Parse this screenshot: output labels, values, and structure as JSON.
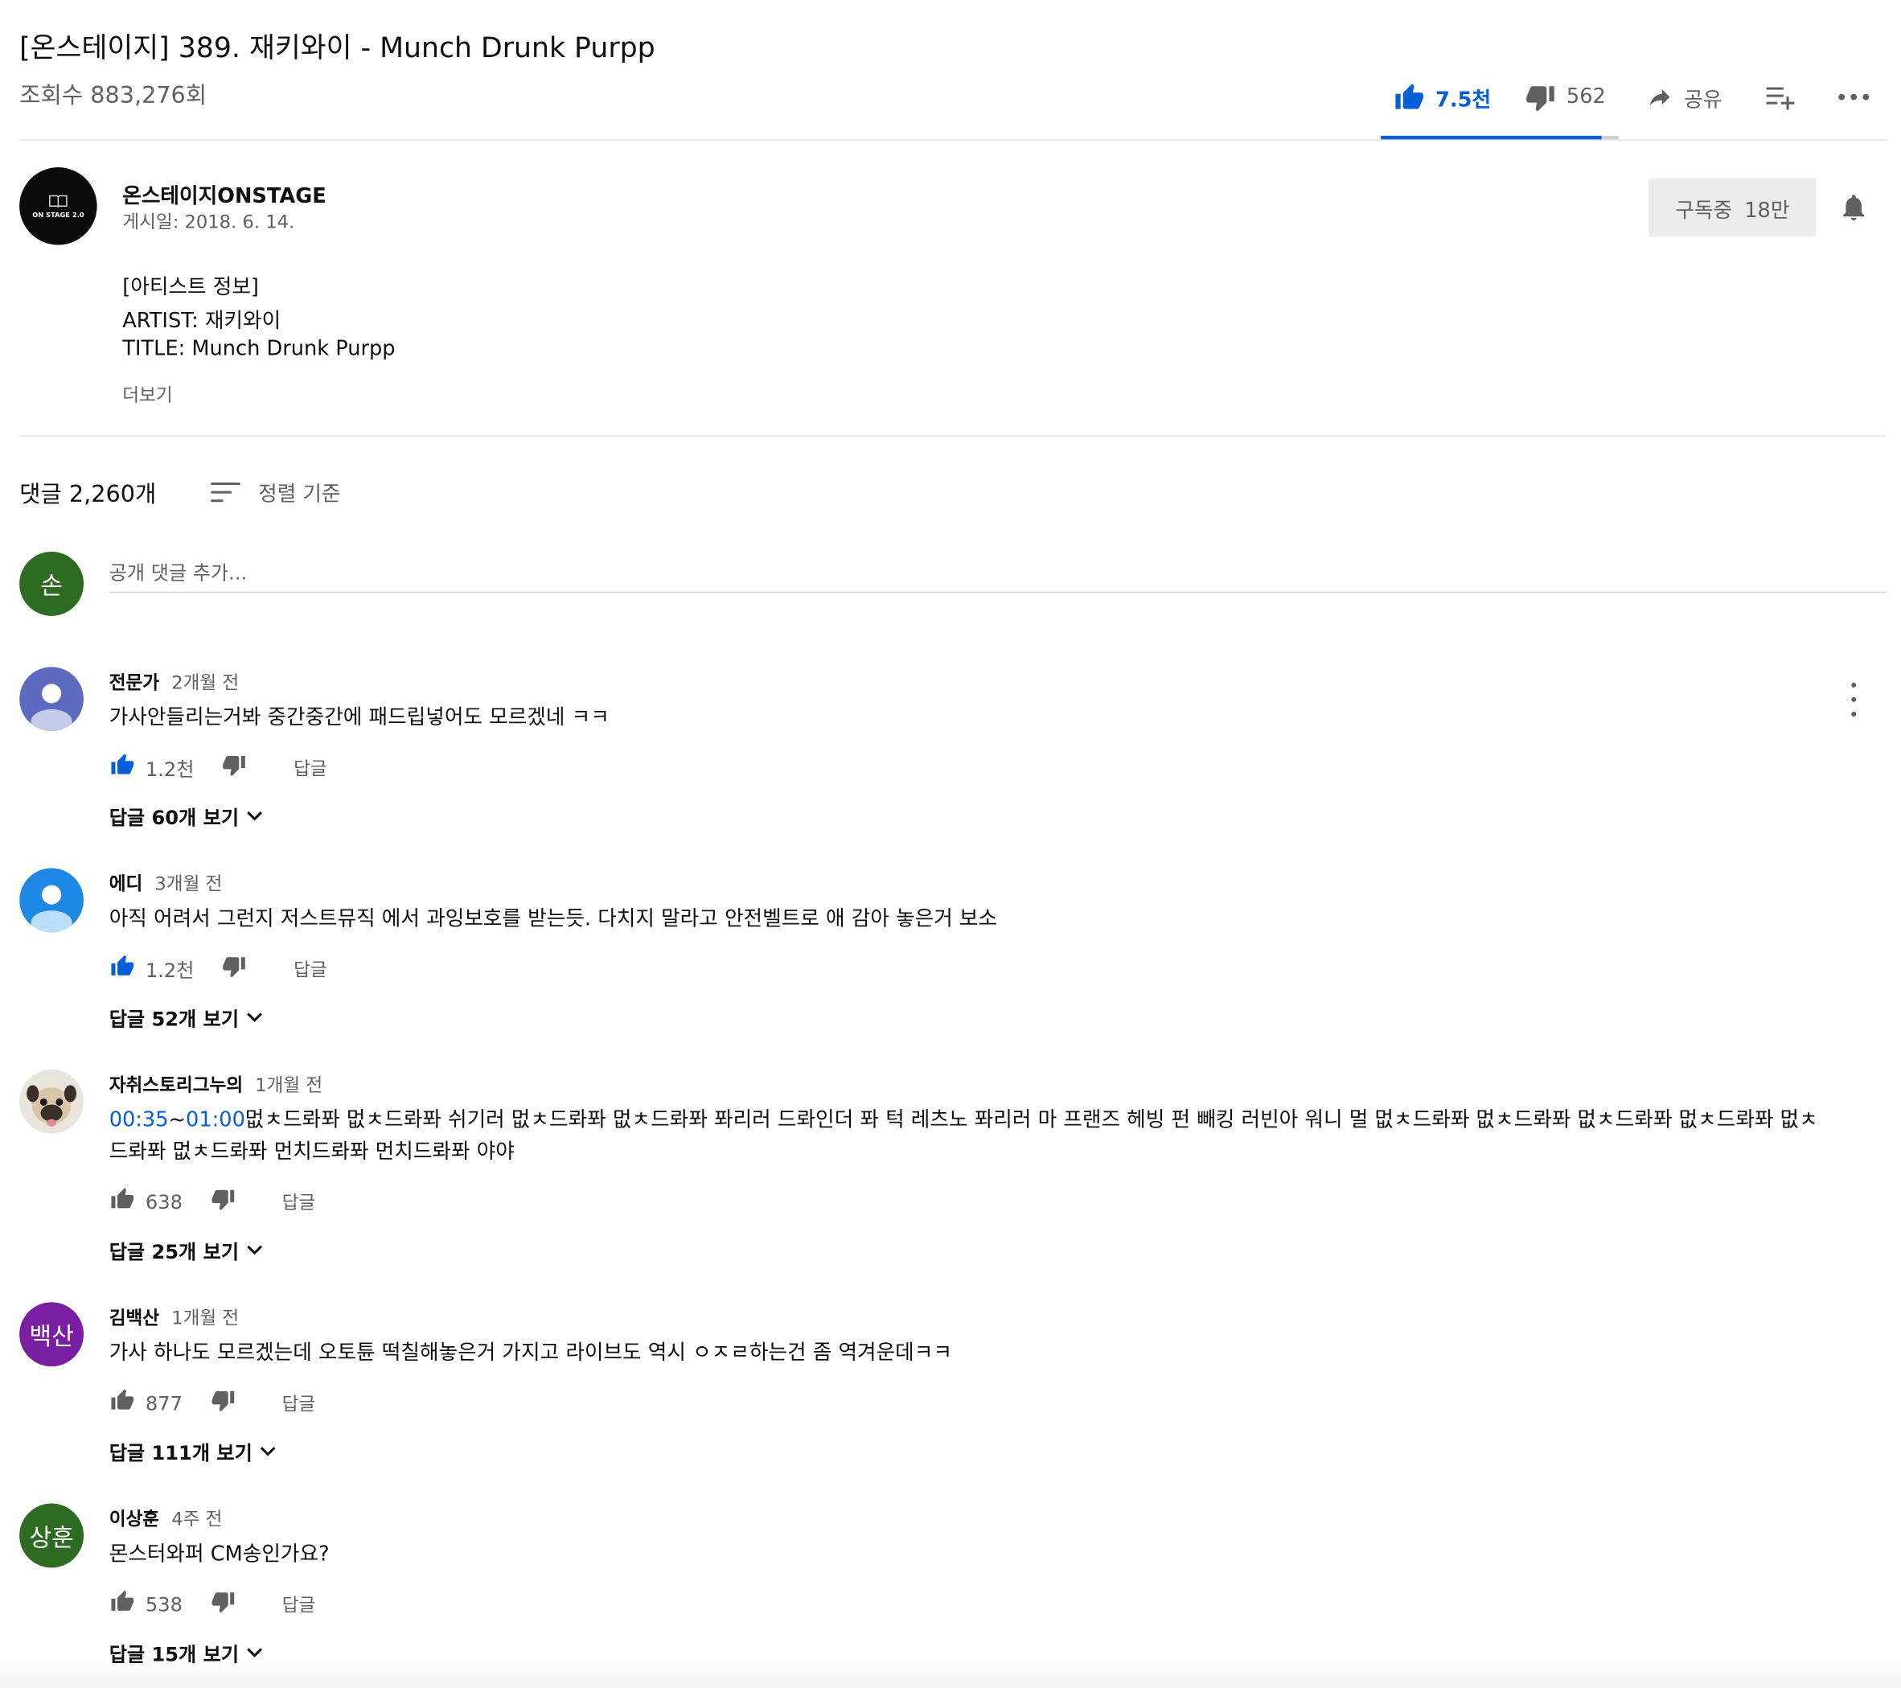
{
  "video": {
    "title": "[온스테이지] 389. 재키와이 - Munch Drunk Purpp",
    "views": "조회수 883,276회"
  },
  "actions": {
    "like_count": "7.5천",
    "dislike_count": "562",
    "share_label": "공유",
    "like_ratio": 0.93
  },
  "channel": {
    "name": "온스테이지ONSTAGE",
    "published": "게시일: 2018. 6. 14.",
    "logo_text": "ON STAGE 2.0",
    "subscribe_label": "구독중",
    "subscriber_count": "18만"
  },
  "description": {
    "lines": [
      "[아티스트 정보]",
      "ARTIST: 재키와이",
      "TITLE: Munch Drunk Purpp"
    ],
    "more_label": "더보기"
  },
  "comments_header": {
    "count": "댓글 2,260개",
    "sort_label": "정렬 기준",
    "input_placeholder": "공개 댓글 추가...",
    "my_avatar": "손"
  },
  "comments": [
    {
      "author": "전문가",
      "time": "2개월 전",
      "text": "가사안들리는거봐 중간중간에 패드립넣어도 모르겠네 ㅋㅋ",
      "likes": "1.2천",
      "reply_label": "답글",
      "replies": "답글 60개 보기",
      "avatar_color": "#5c6bc0",
      "liked": true
    },
    {
      "author": "에디",
      "time": "3개월 전",
      "text": "아직 어려서 그런지 저스트뮤직 에서 과잉보호를 받는듯.  다치지 말라고 안전벨트로 애 감아 놓은거 보소",
      "likes": "1.2천",
      "reply_label": "답글",
      "replies": "답글 52개 보기",
      "avatar_color": "#1e88e5",
      "liked": true
    },
    {
      "author": "자취스토리그누의",
      "time": "1개월 전",
      "ts1": "00:35",
      "ts_sep": "~",
      "ts2": "01:00",
      "text": "멊ㅊ드롸퐈 멊ㅊ드롸퐈 쉬기러 멊ㅊ드롸퐈 멊ㅊ드롸퐈 퐈리러 드롸인더 퐈 턱 레츠노 퐈리러 마 프랜즈 헤빙 펀 빼킹 러빈아 워니 멀 멊ㅊ드롸퐈 멊ㅊ드롸퐈 멊ㅊ드롸퐈 멊ㅊ드롸퐈 멊ㅊ드롸퐈 멊ㅊ드롸퐈 먼치드롸퐈 먼치드롸퐈 야야",
      "likes": "638",
      "reply_label": "답글",
      "replies": "답글 25개 보기",
      "avatar_color": "#e9e4dc",
      "liked": false
    },
    {
      "author": "김백산",
      "time": "1개월 전",
      "text": "가사 하나도 모르겠는데 오토튠 떡칠해놓은거 가지고 라이브도 역시 ㅇㅈㄹ하는건 좀 역겨운데ㅋㅋ",
      "likes": "877",
      "reply_label": "답글",
      "replies": "답글 111개 보기",
      "avatar_text": "백산",
      "avatar_color": "#7b1fa2",
      "liked": false
    },
    {
      "author": "이상훈",
      "time": "4주 전",
      "text": "몬스터와퍼 CM송인가요?",
      "likes": "538",
      "reply_label": "답글",
      "replies": "답글 15개 보기",
      "avatar_text": "상훈",
      "avatar_color": "#2e6b22",
      "liked": false
    }
  ],
  "colors": {
    "accent": "#065fd4",
    "text_primary": "#0f0f0f",
    "text_secondary": "#606060"
  }
}
